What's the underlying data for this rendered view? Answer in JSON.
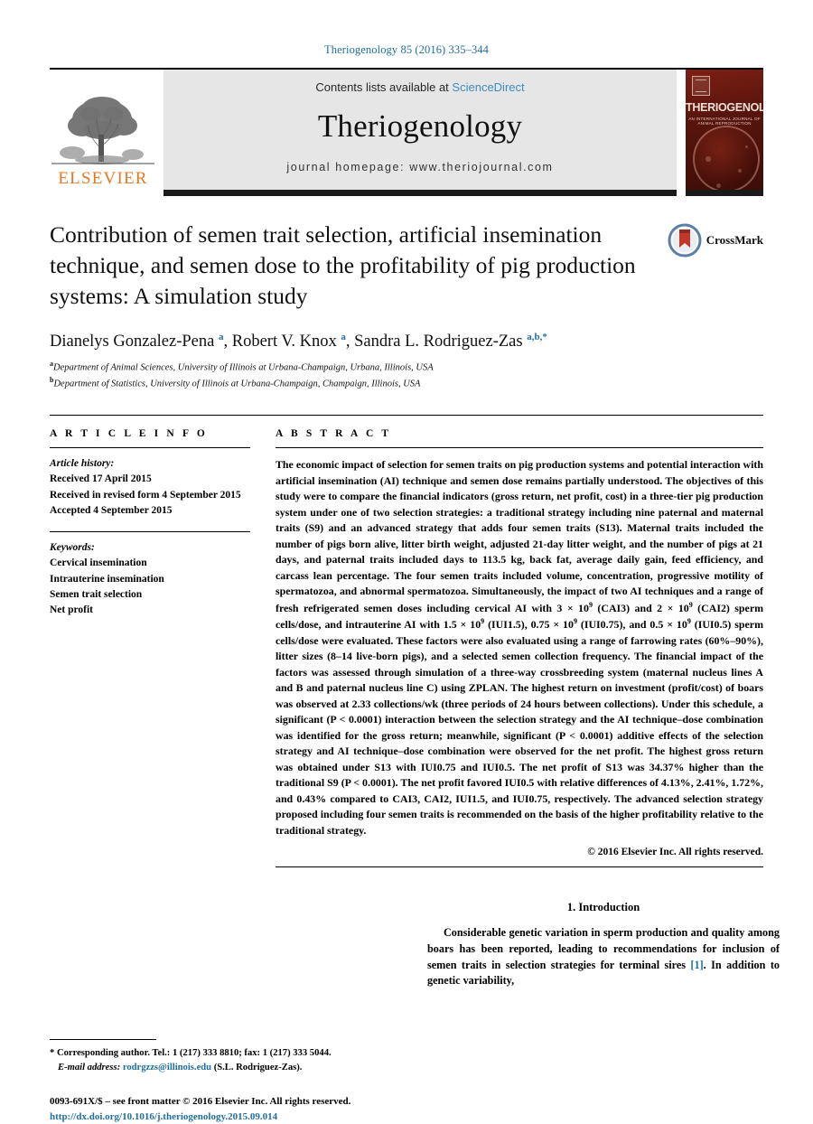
{
  "running_head": "Theriogenology 85 (2016) 335–344",
  "masthead": {
    "publisher_name": "ELSEVIER",
    "contents_prefix": "Contents lists available at",
    "contents_link": "ScienceDirect",
    "journal_title": "Theriogenology",
    "homepage": "journal homepage: www.theriojournal.com",
    "cover_title": "THERIOGENOLOGY",
    "cover_subtitle": "AN INTERNATIONAL JOURNAL OF ANIMAL REPRODUCTION"
  },
  "article": {
    "title": "Contribution of semen trait selection, artificial insemination technique, and semen dose to the profitability of pig production systems: A simulation study",
    "crossmark_label": "CrossMark",
    "authors_html": "Dianelys Gonzalez-Pena <sup>a</sup>, Robert V. Knox <sup>a</sup>, Sandra L. Rodriguez-Zas <sup class=\"star\">a,b,*</sup>",
    "affiliations": [
      {
        "marker": "a",
        "text": "Department of Animal Sciences, University of Illinois at Urbana-Champaign, Urbana, Illinois, USA"
      },
      {
        "marker": "b",
        "text": "Department of Statistics, University of Illinois at Urbana-Champaign, Champaign, Illinois, USA"
      }
    ]
  },
  "article_info": {
    "label": "A R T I C L E   I N F O",
    "history_label": "Article history:",
    "history": [
      "Received 17 April 2015",
      "Received in revised form 4 September 2015",
      "Accepted 4 September 2015"
    ],
    "keywords_label": "Keywords:",
    "keywords": [
      "Cervical insemination",
      "Intrauterine insemination",
      "Semen trait selection",
      "Net profit"
    ]
  },
  "abstract": {
    "label": "A B S T R A C T",
    "html": "The economic impact of selection for semen traits on pig production systems and potential interaction with artificial insemination (AI) technique and semen dose remains partially understood. The objectives of this study were to compare the financial indicators (gross return, net profit, cost) in a three-tier pig production system under one of two selection strategies: a traditional strategy including nine paternal and maternal traits (S9) and an advanced strategy that adds four semen traits (S13). Maternal traits included the number of pigs born alive, litter birth weight, adjusted 21-day litter weight, and the number of pigs at 21 days, and paternal traits included days to 113.5 kg, back fat, average daily gain, feed efficiency, and carcass lean percentage. The four semen traits included volume, concentration, progressive motility of spermatozoa, and abnormal spermatozoa. Simultaneously, the impact of two AI techniques and a range of fresh refrigerated semen doses including cervical AI with 3 × 10<sup>9</sup> (CAI3) and 2 × 10<sup>9</sup> (CAI2) sperm cells/dose, and intrauterine AI with 1.5 × 10<sup>9</sup> (IUI1.5), 0.75 × 10<sup>9</sup> (IUI0.75), and 0.5 × 10<sup>9</sup> (IUI0.5) sperm cells/dose were evaluated. These factors were also evaluated using a range of farrowing rates (60%–90%), litter sizes (8–14 live-born pigs), and a selected semen collection frequency. The financial impact of the factors was assessed through simulation of a three-way crossbreeding system (maternal nucleus lines A and B and paternal nucleus line C) using ZPLAN. The highest return on investment (profit/cost) of boars was observed at 2.33 collections/wk (three periods of 24 hours between collections). Under this schedule, a significant (P &lt; 0.0001) interaction between the selection strategy and the AI technique–dose combination was identified for the gross return; meanwhile, significant (P &lt; 0.0001) additive effects of the selection strategy and AI technique–dose combination were observed for the net profit. The highest gross return was obtained under S13 with IUI0.75 and IUI0.5. The net profit of S13 was 34.37% higher than the traditional S9 (P &lt; 0.0001). The net profit favored IUI0.5 with relative differences of 4.13%, 2.41%, 1.72%, and 0.43% compared to CAI3, CAI2, IUI1.5, and IUI0.75, respectively. The advanced selection strategy proposed including four semen traits is recommended on the basis of the higher profitability relative to the traditional strategy.",
    "copyright": "© 2016 Elsevier Inc. All rights reserved."
  },
  "footer": {
    "corresponding_html": "* Corresponding author. Tel.: 1 (217) 333 8810; fax: 1 (217) 333 5044.",
    "email_label": "E-mail address:",
    "email": "rodrgzzs@illinois.edu",
    "email_attribution": "(S.L. Rodriguez-Zas).",
    "issn_line": "0093-691X/$ – see front matter © 2016 Elsevier Inc. All rights reserved.",
    "doi": "http://dx.doi.org/10.1016/j.theriogenology.2015.09.014"
  },
  "introduction": {
    "heading": "1. Introduction",
    "paragraph_html": "Considerable genetic variation in sperm production and quality among boars has been reported, leading to recommendations for inclusion of semen traits in selection strategies for terminal sires <span class=\"cite\">[1]</span>. In addition to genetic variability,"
  },
  "colors": {
    "link_blue": "#1f6f9e",
    "sciencedirect_blue": "#3e8cc4",
    "elsevier_orange": "#e87722",
    "banner_gray": "#e6e6e6"
  }
}
